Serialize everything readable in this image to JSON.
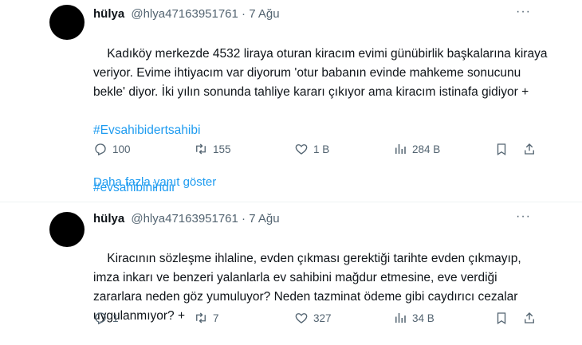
{
  "tweets": [
    {
      "name": "hülya",
      "handle": "@hlya47163951761",
      "sep": "·",
      "date": "7 Ağu",
      "more": "···",
      "text": "Kadıköy merkezde 4532 liraya oturan kiracım evimi günübirlik başkalarına kiraya veriyor. Evime ihtiyacım var diyorum 'otur babanın evinde mahkeme sonucunu bekle' diyor. İki yılın sonunda tahliye kararı çıkıyor ama kiracım istinafa gidiyor +",
      "hashtags": [
        "#Evsahibidertsahibi",
        "#evsahibinindir"
      ],
      "replies": "100",
      "retweets": "155",
      "likes": "1 B",
      "views": "284 B"
    },
    {
      "name": "hülya",
      "handle": "@hlya47163951761",
      "sep": "·",
      "date": "7 Ağu",
      "more": "···",
      "text": "Kiracının sözleşme ihlaline, evden çıkması gerektiği tarihte evden çıkmayıp, imza inkarı ve benzeri yalanlarla ev sahibini mağdur etmesine, eve verdiği zararlara neden göz yumuluyor? Neden tazminat ödeme gibi caydırıcı cezalar uygulanmıyor? +",
      "hashtags": [],
      "replies": "1",
      "retweets": "7",
      "likes": "327",
      "views": "34 B"
    }
  ],
  "show_more": "Daha fazla yanıt göster",
  "colors": {
    "link": "#1d9bf0",
    "muted": "#536471",
    "text": "#0f1419"
  },
  "icons": [
    "reply-icon",
    "retweet-icon",
    "like-icon",
    "views-icon",
    "bookmark-icon",
    "share-icon",
    "more-icon"
  ]
}
